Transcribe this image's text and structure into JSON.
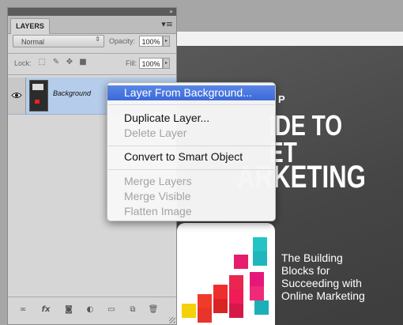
{
  "panel": {
    "tab_label": "LAYERS",
    "blend_mode": "Normal",
    "opacity_label": "Opacity:",
    "opacity_value": "100%",
    "lock_label": "Lock:",
    "fill_label": "Fill:",
    "fill_value": "100%"
  },
  "layers": [
    {
      "name": "Background",
      "visible": true,
      "selected": true
    }
  ],
  "context_menu": {
    "items": [
      {
        "label": "Layer From Background...",
        "enabled": true,
        "highlighted": true
      },
      {
        "label": "Duplicate Layer...",
        "enabled": true
      },
      {
        "label": "Delete Layer",
        "enabled": false
      },
      {
        "label": "Convert to Smart Object",
        "enabled": true
      },
      {
        "label": "Merge Layers",
        "enabled": false
      },
      {
        "label": "Merge Visible",
        "enabled": false
      },
      {
        "label": "Flatten Image",
        "enabled": false
      }
    ]
  },
  "canvas": {
    "cover_title": [
      "P",
      "IDE TO",
      "ET",
      "ARKETING"
    ],
    "tagline": "The Building Blocks for Succeeding with Online Marketing"
  },
  "footer_icons": [
    "link-layers-icon",
    "fx-icon",
    "mask-icon",
    "adjustment-icon",
    "group-icon",
    "new-layer-icon",
    "trash-icon"
  ],
  "colors": {
    "menu_highlight": "#3b69d8",
    "layer_selected": "#b5cdea",
    "panel_bg": "#d6d6d6"
  }
}
